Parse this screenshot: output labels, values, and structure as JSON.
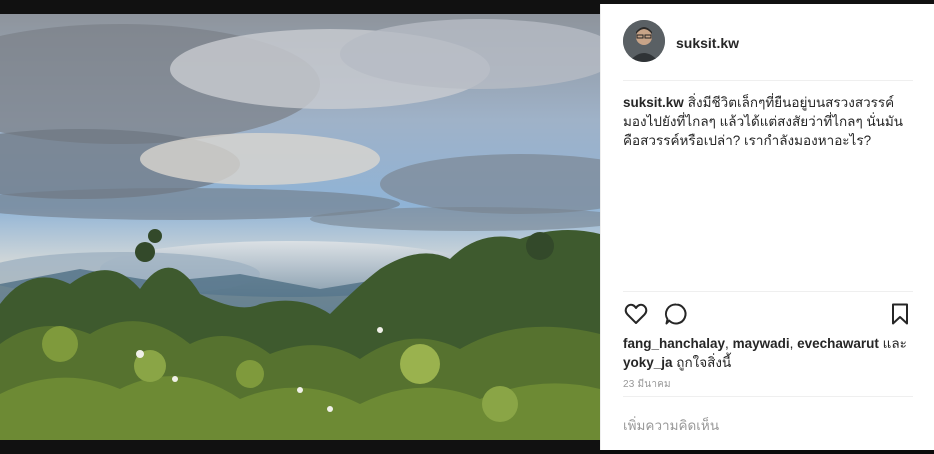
{
  "post": {
    "username": "suksit.kw",
    "caption_user": "suksit.kw",
    "caption_text": "สิ่งมีชีวิตเล็กๆที่ยืนอยู่บนสรวงสวรรค์ มองไปยังที่ไกลๆ แล้วได้แต่สงสัยว่าที่ไกลๆ นั่นมันคือสวรรค์หรือเปล่า? เรากำลังมองหาอะไร?",
    "likes": {
      "user1": "fang_hanchalay",
      "sep1": ", ",
      "user2": "maywadi",
      "sep2": ", ",
      "user3": "evechawarut",
      "and": " และ ",
      "user4": "yoky_ja",
      "suffix": " ถูกใจสิ่งนี้"
    },
    "date": "23 มีนาคม",
    "comment_placeholder": "เพิ่มความคิดเห็น"
  },
  "icons": {
    "like": "heart-icon",
    "comment": "comment-icon",
    "save": "bookmark-icon"
  },
  "colors": {
    "text": "#262626",
    "muted": "#999999",
    "divider": "#efefef"
  }
}
